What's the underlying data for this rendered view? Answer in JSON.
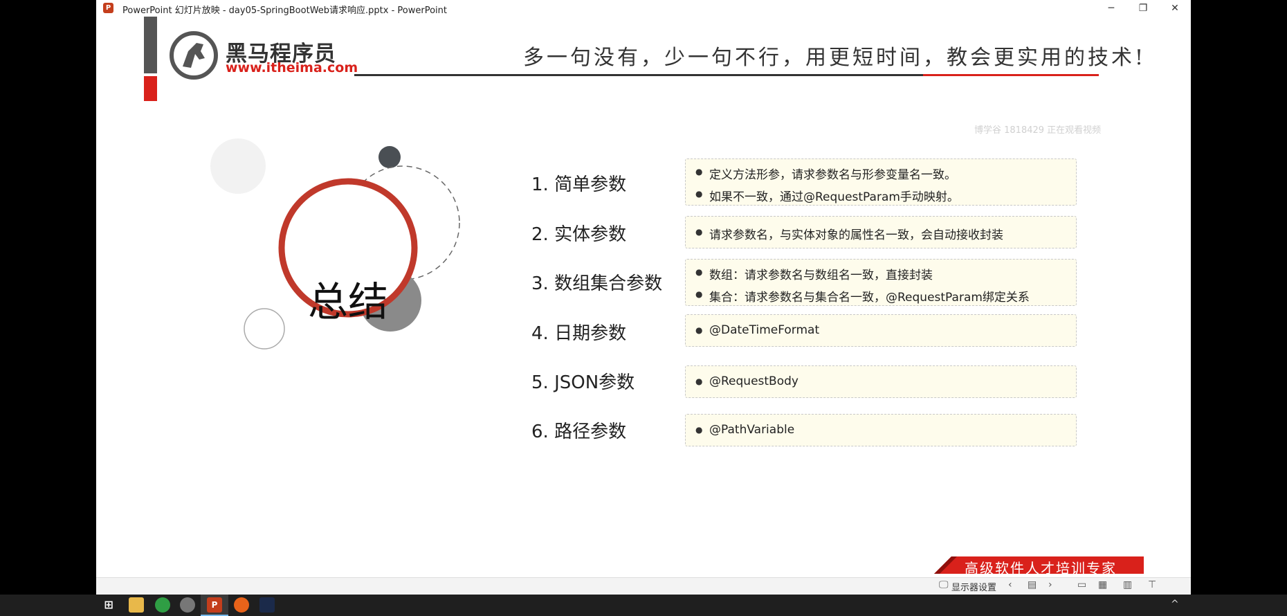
{
  "window": {
    "title": "PowerPoint 幻灯片放映  -  day05-SpringBootWeb请求响应.pptx - PowerPoint",
    "app_icon_letter": "P",
    "minimize": "─",
    "restore": "❐",
    "close": "✕"
  },
  "slide": {
    "logo_cn": "黑马程序员",
    "logo_url": "www.itheima.com",
    "slogan": "多一句没有，少一句不行，用更短时间，教会更实用的技术!",
    "watermark": "博学谷 1818429 正在观看视频",
    "summary_title": "总结",
    "items": [
      {
        "label": "1.  简单参数",
        "bullets": [
          "定义方法形参，请求参数名与形参变量名一致。",
          "如果不一致，通过@RequestParam手动映射。"
        ]
      },
      {
        "label": "2.  实体参数",
        "bullets": [
          "请求参数名，与实体对象的属性名一致，会自动接收封装"
        ]
      },
      {
        "label": "3.  数组集合参数",
        "bullets": [
          "数组：请求参数名与数组名一致，直接封装",
          "集合：请求参数名与集合名一致，@RequestParam绑定关系"
        ]
      },
      {
        "label": "4.  日期参数",
        "bullets": [
          "@DateTimeFormat"
        ]
      },
      {
        "label": "5.  JSON参数",
        "bullets": [
          "@RequestBody"
        ]
      },
      {
        "label": "6.  路径参数",
        "bullets": [
          "@PathVariable"
        ]
      }
    ],
    "footer": "高级软件人才培训专家"
  },
  "statusbar": {
    "display_settings": "显示器设置"
  },
  "colors": {
    "brand_red": "#d9211b",
    "ring_red": "#c0392b",
    "box_fill": "#fefcec"
  }
}
